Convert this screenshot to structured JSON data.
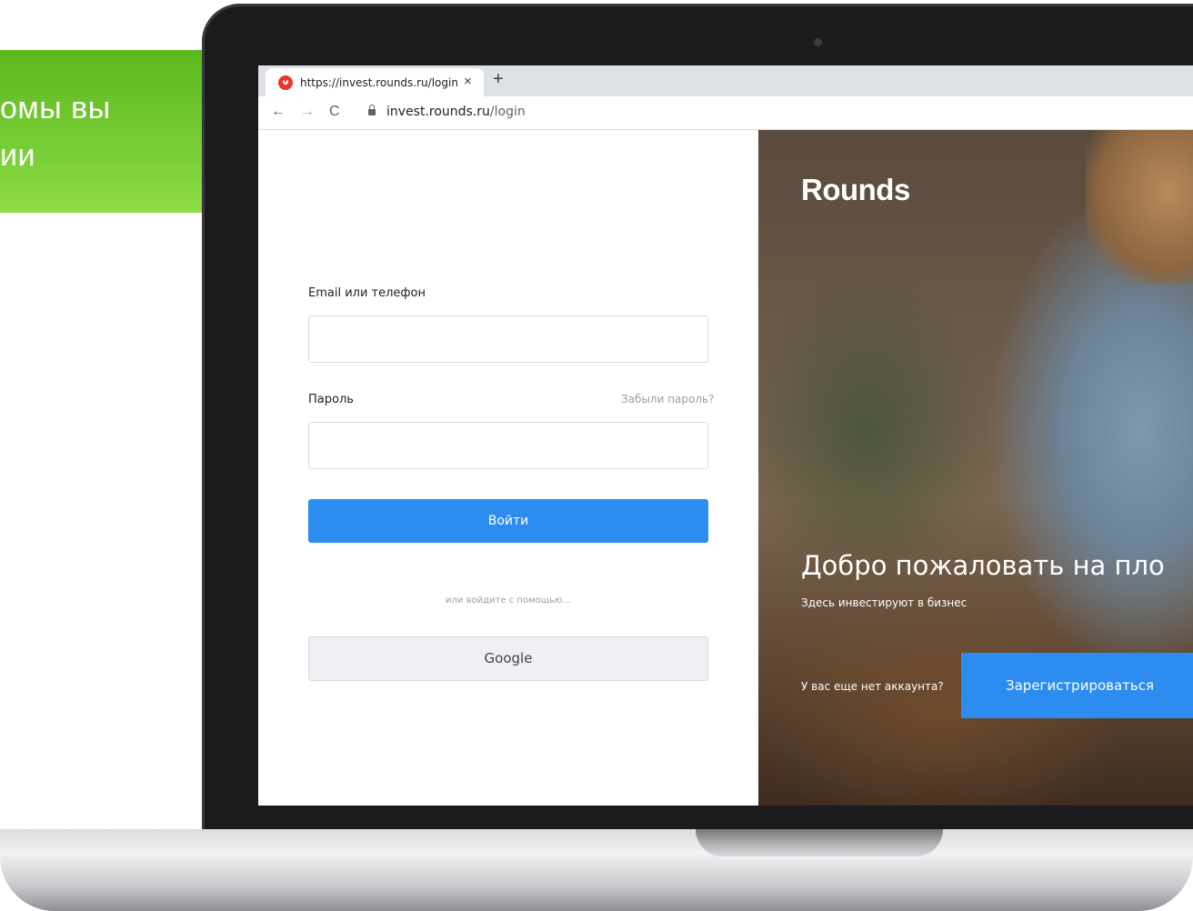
{
  "promo": {
    "line1": "омы вы",
    "line2": "ии"
  },
  "browser": {
    "tab_title": "https://invest.rounds.ru/login",
    "tab_close": "×",
    "new_tab": "+",
    "back": "←",
    "forward": "→",
    "reload": "C",
    "url_host": "invest.rounds.ru",
    "url_path": "/login"
  },
  "login": {
    "email_label": "Email или телефон",
    "password_label": "Пароль",
    "forgot_label": "Забыли пароль?",
    "email_value": "",
    "password_value": "",
    "submit_label": "Войти",
    "alt_text": "или войдите с помощью...",
    "google_label": "Google"
  },
  "hero": {
    "logo": "Rounds",
    "title": "Добро пожаловать на пло",
    "subtitle": "Здесь инвестируют в бизнес",
    "no_account": "У вас еще нет аккаунта?",
    "register_label": "Зарегистрироваться"
  },
  "colors": {
    "accent": "#2d8cf0",
    "promo_green": "#6cc22a",
    "favicon": "#e8352b"
  },
  "icons": [
    "rounds-favicon-icon",
    "close-icon",
    "plus-icon",
    "back-arrow-icon",
    "forward-arrow-icon",
    "reload-icon",
    "lock-icon"
  ]
}
